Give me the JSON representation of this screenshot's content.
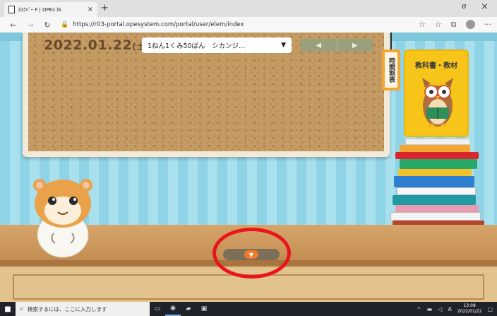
{
  "browser": {
    "tab_title": "ﾀｽｸﾊﾞｰ F | OPEﾙ ﾀﾙ",
    "tab_close": "×",
    "new_tab": "+",
    "url": "https://r03-portal.opesystem.com/portal/user/elem/index",
    "nav": {
      "back": "←",
      "forward": "→",
      "refresh": "↻",
      "lock": "🔒"
    },
    "window": {
      "minimize": "ơ",
      "close": "×"
    },
    "right_icons": {
      "favorite": "☆",
      "favorites_bar": "☆",
      "collections": "⧉",
      "more": "···"
    }
  },
  "board": {
    "date": "2022.01.22",
    "day_of_week": "(土)",
    "class_select": "1ねん1くみ50ばん　シカンジ…",
    "select_arrow": "▼",
    "prev": "◀",
    "next": "▶"
  },
  "timetable_tag": "時間割表",
  "textbook_card": {
    "title": "教科書・教材"
  },
  "drawer_toggle": "▼",
  "taskbar": {
    "start": "■",
    "search_icon": "⌕",
    "search_placeholder": "検索するには、ここに入力します",
    "tray_input": "A",
    "clock_time": "13:08",
    "clock_date": "2022/01/22"
  },
  "colors": {
    "accent_orange": "#f07a2c",
    "highlight_ring": "#e8161c",
    "board_text": "#6b4a2c"
  }
}
